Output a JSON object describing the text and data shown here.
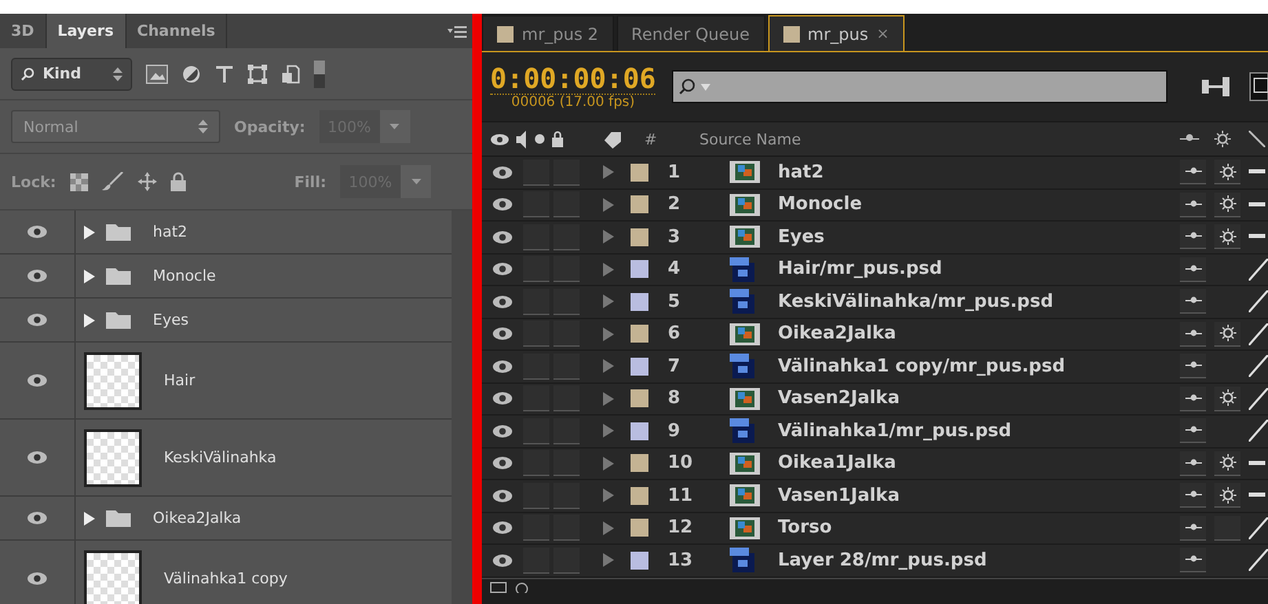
{
  "layers_panel": {
    "tabs": [
      {
        "label": "3D",
        "selected": false
      },
      {
        "label": "Layers",
        "selected": true
      },
      {
        "label": "Channels",
        "selected": false
      }
    ],
    "filter": {
      "label": "Kind"
    },
    "blend_mode": "Normal",
    "opacity_label": "Opacity:",
    "opacity_value": "100%",
    "lock_label": "Lock:",
    "fill_label": "Fill:",
    "fill_value": "100%",
    "layers": [
      {
        "name": "hat2",
        "kind": "group",
        "visible": true
      },
      {
        "name": "Monocle",
        "kind": "group",
        "visible": true
      },
      {
        "name": "Eyes",
        "kind": "group",
        "visible": true
      },
      {
        "name": "Hair",
        "kind": "layer",
        "visible": true
      },
      {
        "name": "KeskiVälinahka",
        "kind": "layer",
        "visible": true
      },
      {
        "name": "Oikea2Jalka",
        "kind": "group",
        "visible": true
      },
      {
        "name": "Välinahka1 copy",
        "kind": "layer",
        "visible": true
      }
    ]
  },
  "timeline": {
    "tabs": [
      {
        "label": "mr_pus 2",
        "kind": "comp",
        "selected": false
      },
      {
        "label": "Render Queue",
        "kind": "queue",
        "selected": false
      },
      {
        "label": "mr_pus",
        "kind": "comp",
        "selected": true,
        "close": "×"
      }
    ],
    "timecode": "0:00:00:06",
    "frame_info": "00006 (17.00 fps)",
    "columns": {
      "number": "#",
      "source_name": "Source Name"
    },
    "layers": [
      {
        "number": "1",
        "name": "hat2",
        "kind": "comp",
        "color": "#c4b393",
        "visible": true,
        "solo": false,
        "locked": false,
        "shy": false,
        "collapsed": true,
        "best_quality": false
      },
      {
        "number": "2",
        "name": "Monocle",
        "kind": "comp",
        "color": "#c4b393",
        "visible": true,
        "solo": false,
        "locked": false,
        "shy": false,
        "collapsed": true,
        "best_quality": false
      },
      {
        "number": "3",
        "name": "Eyes",
        "kind": "comp",
        "color": "#c4b393",
        "visible": true,
        "solo": false,
        "locked": false,
        "shy": false,
        "collapsed": true,
        "best_quality": false
      },
      {
        "number": "4",
        "name": "Hair/mr_pus.psd",
        "kind": "psd",
        "color": "#b9bde0",
        "visible": true,
        "solo": false,
        "locked": false,
        "shy": false,
        "best_quality": true
      },
      {
        "number": "5",
        "name": "KeskiVälinahka/mr_pus.psd",
        "kind": "psd",
        "color": "#b9bde0",
        "visible": true,
        "solo": false,
        "locked": false,
        "shy": false,
        "best_quality": true
      },
      {
        "number": "6",
        "name": "Oikea2Jalka",
        "kind": "comp",
        "color": "#c4b393",
        "visible": true,
        "solo": false,
        "locked": false,
        "shy": false,
        "collapsed": true,
        "best_quality": true
      },
      {
        "number": "7",
        "name": "Välinahka1 copy/mr_pus.psd",
        "kind": "psd",
        "color": "#b9bde0",
        "visible": true,
        "solo": false,
        "locked": false,
        "shy": false,
        "best_quality": true
      },
      {
        "number": "8",
        "name": "Vasen2Jalka",
        "kind": "comp",
        "color": "#c4b393",
        "visible": true,
        "solo": false,
        "locked": false,
        "shy": false,
        "collapsed": true,
        "best_quality": true
      },
      {
        "number": "9",
        "name": "Välinahka1/mr_pus.psd",
        "kind": "psd",
        "color": "#b9bde0",
        "visible": true,
        "solo": false,
        "locked": false,
        "shy": false,
        "best_quality": true
      },
      {
        "number": "10",
        "name": "Oikea1Jalka",
        "kind": "comp",
        "color": "#c4b393",
        "visible": true,
        "solo": false,
        "locked": false,
        "shy": false,
        "collapsed": true,
        "best_quality": false
      },
      {
        "number": "11",
        "name": "Vasen1Jalka",
        "kind": "comp",
        "color": "#c4b393",
        "visible": true,
        "solo": false,
        "locked": false,
        "shy": false,
        "collapsed": true,
        "best_quality": false
      },
      {
        "number": "12",
        "name": "Torso",
        "kind": "comp",
        "color": "#c4b393",
        "visible": true,
        "solo": false,
        "locked": false,
        "shy": false,
        "collapsed": false,
        "best_quality": true
      },
      {
        "number": "13",
        "name": "Layer 28/mr_pus.psd",
        "kind": "psd",
        "color": "#b9bde0",
        "visible": true,
        "solo": false,
        "locked": false,
        "shy": false,
        "best_quality": true
      }
    ]
  }
}
